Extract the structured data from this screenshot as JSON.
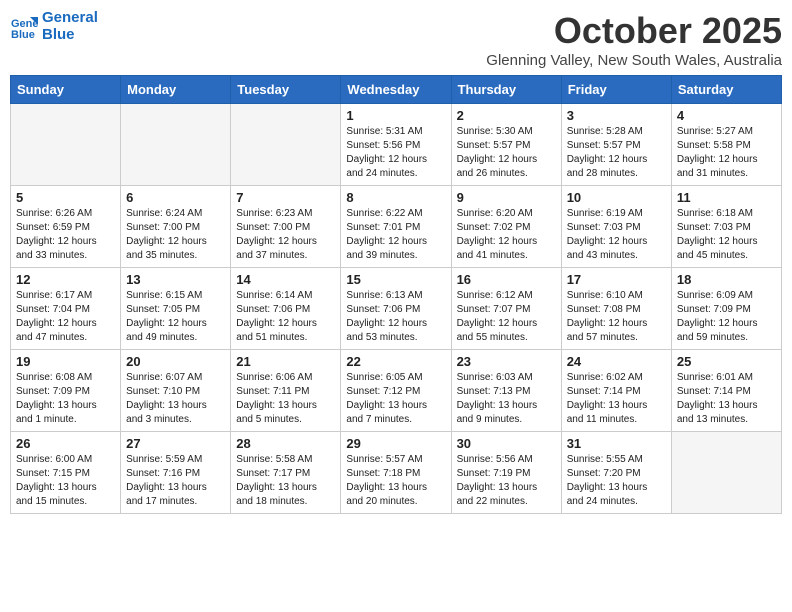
{
  "logo": {
    "line1": "General",
    "line2": "Blue"
  },
  "title": "October 2025",
  "subtitle": "Glenning Valley, New South Wales, Australia",
  "weekdays": [
    "Sunday",
    "Monday",
    "Tuesday",
    "Wednesday",
    "Thursday",
    "Friday",
    "Saturday"
  ],
  "weeks": [
    [
      {
        "day": "",
        "info": ""
      },
      {
        "day": "",
        "info": ""
      },
      {
        "day": "",
        "info": ""
      },
      {
        "day": "1",
        "info": "Sunrise: 5:31 AM\nSunset: 5:56 PM\nDaylight: 12 hours\nand 24 minutes."
      },
      {
        "day": "2",
        "info": "Sunrise: 5:30 AM\nSunset: 5:57 PM\nDaylight: 12 hours\nand 26 minutes."
      },
      {
        "day": "3",
        "info": "Sunrise: 5:28 AM\nSunset: 5:57 PM\nDaylight: 12 hours\nand 28 minutes."
      },
      {
        "day": "4",
        "info": "Sunrise: 5:27 AM\nSunset: 5:58 PM\nDaylight: 12 hours\nand 31 minutes."
      }
    ],
    [
      {
        "day": "5",
        "info": "Sunrise: 6:26 AM\nSunset: 6:59 PM\nDaylight: 12 hours\nand 33 minutes."
      },
      {
        "day": "6",
        "info": "Sunrise: 6:24 AM\nSunset: 7:00 PM\nDaylight: 12 hours\nand 35 minutes."
      },
      {
        "day": "7",
        "info": "Sunrise: 6:23 AM\nSunset: 7:00 PM\nDaylight: 12 hours\nand 37 minutes."
      },
      {
        "day": "8",
        "info": "Sunrise: 6:22 AM\nSunset: 7:01 PM\nDaylight: 12 hours\nand 39 minutes."
      },
      {
        "day": "9",
        "info": "Sunrise: 6:20 AM\nSunset: 7:02 PM\nDaylight: 12 hours\nand 41 minutes."
      },
      {
        "day": "10",
        "info": "Sunrise: 6:19 AM\nSunset: 7:03 PM\nDaylight: 12 hours\nand 43 minutes."
      },
      {
        "day": "11",
        "info": "Sunrise: 6:18 AM\nSunset: 7:03 PM\nDaylight: 12 hours\nand 45 minutes."
      }
    ],
    [
      {
        "day": "12",
        "info": "Sunrise: 6:17 AM\nSunset: 7:04 PM\nDaylight: 12 hours\nand 47 minutes."
      },
      {
        "day": "13",
        "info": "Sunrise: 6:15 AM\nSunset: 7:05 PM\nDaylight: 12 hours\nand 49 minutes."
      },
      {
        "day": "14",
        "info": "Sunrise: 6:14 AM\nSunset: 7:06 PM\nDaylight: 12 hours\nand 51 minutes."
      },
      {
        "day": "15",
        "info": "Sunrise: 6:13 AM\nSunset: 7:06 PM\nDaylight: 12 hours\nand 53 minutes."
      },
      {
        "day": "16",
        "info": "Sunrise: 6:12 AM\nSunset: 7:07 PM\nDaylight: 12 hours\nand 55 minutes."
      },
      {
        "day": "17",
        "info": "Sunrise: 6:10 AM\nSunset: 7:08 PM\nDaylight: 12 hours\nand 57 minutes."
      },
      {
        "day": "18",
        "info": "Sunrise: 6:09 AM\nSunset: 7:09 PM\nDaylight: 12 hours\nand 59 minutes."
      }
    ],
    [
      {
        "day": "19",
        "info": "Sunrise: 6:08 AM\nSunset: 7:09 PM\nDaylight: 13 hours\nand 1 minute."
      },
      {
        "day": "20",
        "info": "Sunrise: 6:07 AM\nSunset: 7:10 PM\nDaylight: 13 hours\nand 3 minutes."
      },
      {
        "day": "21",
        "info": "Sunrise: 6:06 AM\nSunset: 7:11 PM\nDaylight: 13 hours\nand 5 minutes."
      },
      {
        "day": "22",
        "info": "Sunrise: 6:05 AM\nSunset: 7:12 PM\nDaylight: 13 hours\nand 7 minutes."
      },
      {
        "day": "23",
        "info": "Sunrise: 6:03 AM\nSunset: 7:13 PM\nDaylight: 13 hours\nand 9 minutes."
      },
      {
        "day": "24",
        "info": "Sunrise: 6:02 AM\nSunset: 7:14 PM\nDaylight: 13 hours\nand 11 minutes."
      },
      {
        "day": "25",
        "info": "Sunrise: 6:01 AM\nSunset: 7:14 PM\nDaylight: 13 hours\nand 13 minutes."
      }
    ],
    [
      {
        "day": "26",
        "info": "Sunrise: 6:00 AM\nSunset: 7:15 PM\nDaylight: 13 hours\nand 15 minutes."
      },
      {
        "day": "27",
        "info": "Sunrise: 5:59 AM\nSunset: 7:16 PM\nDaylight: 13 hours\nand 17 minutes."
      },
      {
        "day": "28",
        "info": "Sunrise: 5:58 AM\nSunset: 7:17 PM\nDaylight: 13 hours\nand 18 minutes."
      },
      {
        "day": "29",
        "info": "Sunrise: 5:57 AM\nSunset: 7:18 PM\nDaylight: 13 hours\nand 20 minutes."
      },
      {
        "day": "30",
        "info": "Sunrise: 5:56 AM\nSunset: 7:19 PM\nDaylight: 13 hours\nand 22 minutes."
      },
      {
        "day": "31",
        "info": "Sunrise: 5:55 AM\nSunset: 7:20 PM\nDaylight: 13 hours\nand 24 minutes."
      },
      {
        "day": "",
        "info": ""
      }
    ]
  ]
}
